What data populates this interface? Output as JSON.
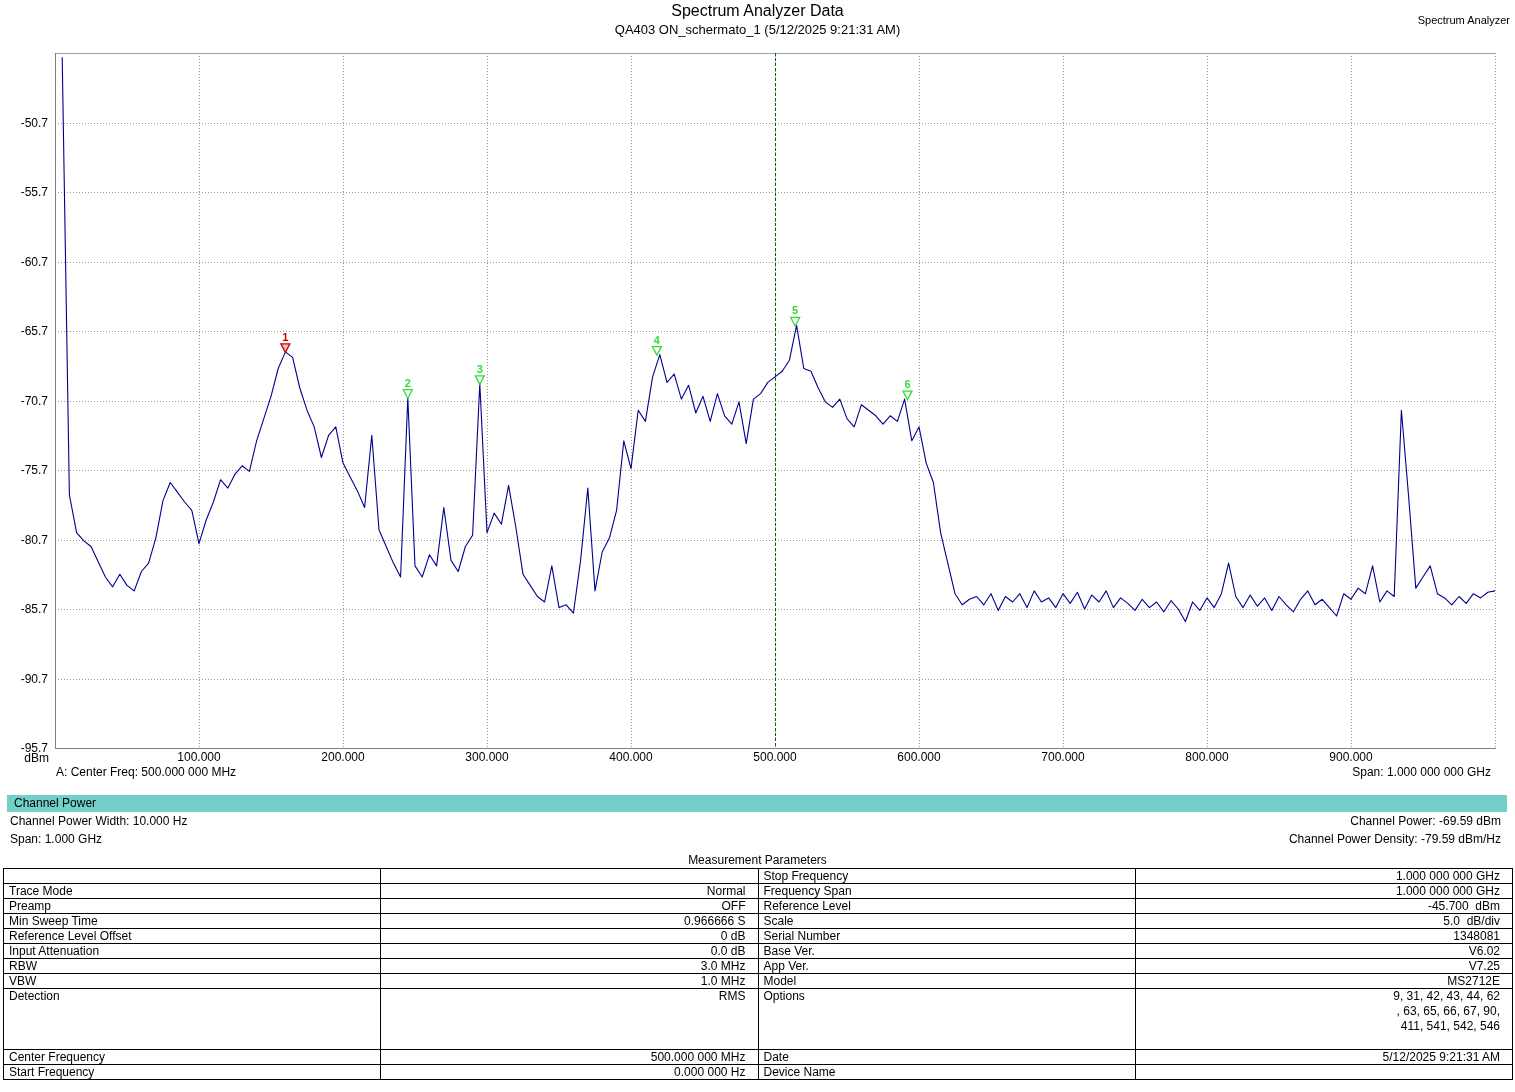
{
  "header": {
    "title": "Spectrum Analyzer Data",
    "subtitle": "QA403 ON_schermato_1 (5/12/2025 9:21:31 AM)",
    "instrument": "Spectrum Analyzer"
  },
  "spectrum_plot": {
    "chart_data": {
      "type": "line",
      "ylabel": "dBm",
      "grid": true,
      "x": [
        5,
        10,
        15,
        20,
        25,
        30,
        35,
        40,
        45,
        50,
        55,
        60,
        65,
        70,
        75,
        80,
        85,
        90,
        95,
        100,
        105,
        110,
        115,
        120,
        125,
        130,
        135,
        140,
        145,
        150,
        155,
        160,
        165,
        170,
        175,
        180,
        185,
        190,
        195,
        200,
        205,
        210,
        215,
        220,
        225,
        230,
        235,
        240,
        245,
        250,
        255,
        260,
        265,
        270,
        275,
        280,
        285,
        290,
        295,
        300,
        305,
        310,
        315,
        320,
        325,
        330,
        335,
        340,
        345,
        350,
        355,
        360,
        365,
        370,
        375,
        380,
        385,
        390,
        395,
        400,
        405,
        410,
        415,
        420,
        425,
        430,
        435,
        440,
        445,
        450,
        455,
        460,
        465,
        470,
        475,
        480,
        485,
        490,
        495,
        500,
        505,
        510,
        515,
        520,
        525,
        530,
        535,
        540,
        545,
        550,
        555,
        560,
        565,
        570,
        575,
        580,
        585,
        590,
        595,
        600,
        605,
        610,
        615,
        620,
        625,
        630,
        635,
        640,
        645,
        650,
        655,
        660,
        665,
        670,
        675,
        680,
        685,
        690,
        695,
        700,
        705,
        710,
        715,
        720,
        725,
        730,
        735,
        740,
        745,
        750,
        755,
        760,
        765,
        770,
        775,
        780,
        785,
        790,
        795,
        800,
        805,
        810,
        815,
        820,
        825,
        830,
        835,
        840,
        845,
        850,
        855,
        860,
        865,
        870,
        875,
        880,
        885,
        890,
        895,
        900,
        905,
        910,
        915,
        920,
        925,
        930,
        935,
        940,
        945,
        950,
        955,
        960,
        965,
        970,
        975,
        980,
        985,
        990,
        995,
        1000
      ],
      "values": [
        -46.0,
        -77.5,
        -80.2,
        -80.8,
        -81.2,
        -82.3,
        -83.4,
        -84.1,
        -83.2,
        -84.0,
        -84.4,
        -83.0,
        -82.4,
        -80.6,
        -77.9,
        -76.6,
        -77.3,
        -78.0,
        -78.6,
        -81.0,
        -79.3,
        -78.0,
        -76.4,
        -77.0,
        -76.0,
        -75.4,
        -75.8,
        -73.6,
        -72.0,
        -70.4,
        -68.4,
        -67.2,
        -67.6,
        -69.8,
        -71.4,
        -72.6,
        -74.8,
        -73.2,
        -72.6,
        -75.2,
        -76.2,
        -77.2,
        -78.4,
        -73.2,
        -80.0,
        -81.2,
        -82.4,
        -83.4,
        -70.5,
        -82.6,
        -83.4,
        -81.8,
        -82.6,
        -78.4,
        -82.2,
        -83.0,
        -81.2,
        -80.4,
        -69.5,
        -80.2,
        -78.8,
        -79.6,
        -76.8,
        -79.8,
        -83.2,
        -84.0,
        -84.8,
        -85.2,
        -82.6,
        -85.6,
        -85.4,
        -86.0,
        -82.2,
        -77.0,
        -84.4,
        -81.6,
        -80.6,
        -78.6,
        -73.6,
        -75.6,
        -71.4,
        -72.2,
        -69.0,
        -67.4,
        -69.4,
        -68.8,
        -70.6,
        -69.6,
        -71.6,
        -70.4,
        -72.2,
        -70.2,
        -71.8,
        -72.4,
        -70.8,
        -73.8,
        -70.6,
        -70.2,
        -69.4,
        -69.0,
        -68.6,
        -67.8,
        -65.3,
        -68.4,
        -68.6,
        -69.8,
        -70.8,
        -71.2,
        -70.6,
        -72.0,
        -72.6,
        -71.0,
        -71.4,
        -71.8,
        -72.4,
        -71.8,
        -72.2,
        -70.6,
        -73.6,
        -72.6,
        -75.2,
        -76.6,
        -80.2,
        -82.4,
        -84.6,
        -85.4,
        -85.0,
        -84.8,
        -85.4,
        -84.6,
        -85.8,
        -84.8,
        -85.2,
        -84.6,
        -85.6,
        -84.4,
        -85.2,
        -84.9,
        -85.6,
        -84.6,
        -85.3,
        -84.5,
        -85.7,
        -84.7,
        -85.2,
        -84.4,
        -85.6,
        -84.9,
        -85.3,
        -85.8,
        -85.0,
        -85.6,
        -85.2,
        -85.9,
        -85.1,
        -85.7,
        -86.6,
        -85.2,
        -85.8,
        -84.9,
        -85.6,
        -84.6,
        -82.4,
        -84.8,
        -85.6,
        -84.7,
        -85.5,
        -84.9,
        -85.8,
        -84.8,
        -85.4,
        -85.9,
        -85.0,
        -84.4,
        -85.4,
        -85.0,
        -85.6,
        -86.2,
        -84.6,
        -85.0,
        -84.2,
        -84.6,
        -82.6,
        -85.2,
        -84.4,
        -84.8,
        -71.4,
        -77.6,
        -84.2,
        -83.4,
        -82.6,
        -84.6,
        -84.9,
        -85.4,
        -84.8,
        -85.3,
        -84.6,
        -84.9,
        -84.5,
        -84.4
      ],
      "xlim": [
        0,
        1000
      ],
      "ylim": [
        -95.7,
        -45.7
      ],
      "xticks": [
        {
          "value": 100,
          "label": "100.000"
        },
        {
          "value": 200,
          "label": "200.000"
        },
        {
          "value": 300,
          "label": "300.000"
        },
        {
          "value": 400,
          "label": "400.000"
        },
        {
          "value": 500,
          "label": "500.000"
        },
        {
          "value": 600,
          "label": "600.000"
        },
        {
          "value": 700,
          "label": "700.000"
        },
        {
          "value": 800,
          "label": "800.000"
        },
        {
          "value": 900,
          "label": "900.000"
        }
      ],
      "yticks": [
        -50.7,
        -55.7,
        -60.7,
        -65.7,
        -70.7,
        -75.7,
        -80.7,
        -85.7,
        -90.7,
        -95.7
      ],
      "annotations": [
        {
          "text": "1",
          "x": 160,
          "y": -67.2
        },
        {
          "text": "2",
          "x": 245,
          "y": -70.5
        },
        {
          "text": "3",
          "x": 295,
          "y": -69.5
        },
        {
          "text": "4",
          "x": 418,
          "y": -67.4
        },
        {
          "text": "5",
          "x": 514,
          "y": -65.3
        },
        {
          "text": "6",
          "x": 592,
          "y": -70.6
        }
      ],
      "ref_lines": [
        {
          "axis": "x",
          "value": 500,
          "color": "#006400"
        }
      ]
    },
    "markers": [
      {
        "selected": true
      },
      {
        "selected": false
      },
      {
        "selected": false
      },
      {
        "selected": false
      },
      {
        "selected": false
      },
      {
        "selected": false
      }
    ],
    "center_frequency": "A: Center Freq: 500.000 000 MHz",
    "span": "Span: 1.000 000 000 GHz"
  },
  "channel_power": {
    "title": "Channel Power",
    "rows": [
      {
        "left": "Channel Power Width: 10.000 Hz",
        "right": "Channel Power: -69.59 dBm"
      },
      {
        "left": "Span: 1.000 GHz",
        "right": "Channel Power Density: -79.59 dBm/Hz"
      }
    ]
  },
  "measurement_parameters": {
    "title": "Measurement Parameters",
    "rows": [
      {
        "name_2": "Stop Frequency",
        "value_2": "1.000 000 000 GHz"
      },
      {
        "name_1": "Trace Mode",
        "value_1": "Normal",
        "name_2": "Frequency Span",
        "value_2": "1.000 000 000 GHz"
      },
      {
        "name_1": "Preamp",
        "value_1": "OFF",
        "name_2": "Reference Level",
        "value_2": "-45.700  dBm"
      },
      {
        "name_1": "Min Sweep Time",
        "value_1": "0.966666 S",
        "name_2": "Scale",
        "value_2": "5.0  dB/div"
      },
      {
        "name_1": "Reference Level Offset",
        "value_1": "0 dB",
        "name_2": "Serial Number",
        "value_2": "1348081"
      },
      {
        "name_1": "Input Attenuation",
        "value_1": "0.0 dB",
        "name_2": "Base Ver.",
        "value_2": "V6.02"
      },
      {
        "name_1": "RBW",
        "value_1": "3.0 MHz",
        "name_2": "App Ver.",
        "value_2": "V7.25"
      },
      {
        "name_1": "VBW",
        "value_1": "1.0 MHz",
        "name_2": "Model",
        "value_2": "MS2712E"
      },
      {
        "name_1": "Detection",
        "value_1": "RMS",
        "name_2": "Options",
        "value_2": "9, 31, 42, 43, 44, 62\n, 63, 65, 66, 67, 90,\n411, 541, 542, 546"
      },
      {
        "name_1": "Center Frequency",
        "value_1": "500.000 000 MHz",
        "name_2": "Date",
        "value_2": "5/12/2025 9:21:31 AM"
      },
      {
        "name_1": "Start Frequency",
        "value_1": "0.000 000 Hz",
        "name_2": "Device Name"
      }
    ]
  }
}
